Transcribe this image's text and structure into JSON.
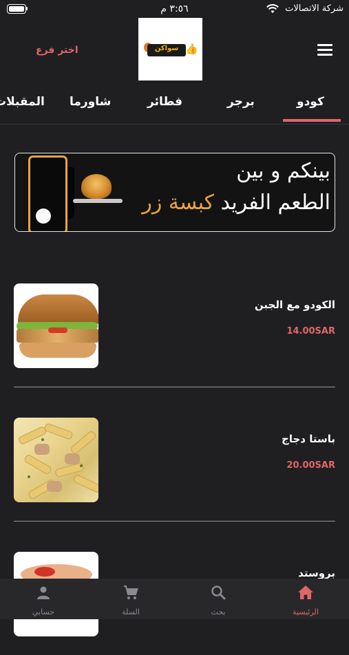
{
  "status_bar": {
    "time": "٣:٥٦ م",
    "carrier": "شركة الاتصالات"
  },
  "header": {
    "branch_label": "اختر فرع",
    "logo_text": "سواكن"
  },
  "tabs": [
    {
      "label": "كودو",
      "active": true
    },
    {
      "label": "برجر",
      "active": false
    },
    {
      "label": "فطائر",
      "active": false
    },
    {
      "label": "شاورما",
      "active": false
    },
    {
      "label": "المقبلات",
      "active": false
    }
  ],
  "banner": {
    "line1": "بينكم و بين",
    "line2_prefix": "الطعم الفريد",
    "line2_brand": "كبسة زر"
  },
  "products": [
    {
      "name": "الكودو مع الجبن",
      "price": "14.00SAR"
    },
    {
      "name": "باستا دجاج",
      "price": "20.00SAR"
    },
    {
      "name": "بروستد",
      "price": ""
    }
  ],
  "bottom_nav": [
    {
      "label": "حسابي",
      "icon": "person-icon",
      "active": false
    },
    {
      "label": "السلة",
      "icon": "cart-icon",
      "active": false
    },
    {
      "label": "بحث",
      "icon": "search-icon",
      "active": false
    },
    {
      "label": "الرئيسية",
      "icon": "home-icon",
      "active": true
    }
  ],
  "colors": {
    "accent": "#e06666",
    "background": "#1f1f22",
    "nav_background": "#28282b",
    "brand_gold": "#e9a440"
  }
}
